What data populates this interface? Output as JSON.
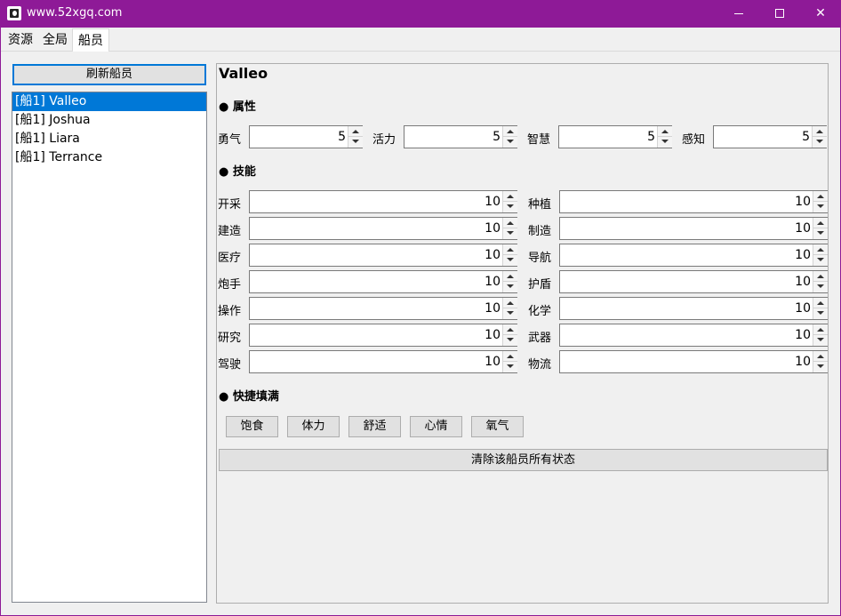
{
  "window": {
    "title": "www.52xgq.com"
  },
  "tabs": [
    {
      "label": "资源"
    },
    {
      "label": "全局"
    },
    {
      "label": "船员"
    }
  ],
  "refresh_label": "刷新船员",
  "crew": [
    {
      "label": "[船1] Valleo"
    },
    {
      "label": "[船1] Joshua"
    },
    {
      "label": "[船1] Liara"
    },
    {
      "label": "[船1] Terrance"
    }
  ],
  "selected_name": "Valleo",
  "attributes_title": "● 属性",
  "attributes": [
    {
      "label": "勇气",
      "value": "5"
    },
    {
      "label": "活力",
      "value": "5"
    },
    {
      "label": "智慧",
      "value": "5"
    },
    {
      "label": "感知",
      "value": "5"
    }
  ],
  "skills_title": "● 技能",
  "skills": [
    {
      "label": "开采",
      "value": "10"
    },
    {
      "label": "种植",
      "value": "10"
    },
    {
      "label": "建造",
      "value": "10"
    },
    {
      "label": "制造",
      "value": "10"
    },
    {
      "label": "医疗",
      "value": "10"
    },
    {
      "label": "导航",
      "value": "10"
    },
    {
      "label": "炮手",
      "value": "10"
    },
    {
      "label": "护盾",
      "value": "10"
    },
    {
      "label": "操作",
      "value": "10"
    },
    {
      "label": "化学",
      "value": "10"
    },
    {
      "label": "研究",
      "value": "10"
    },
    {
      "label": "武器",
      "value": "10"
    },
    {
      "label": "驾驶",
      "value": "10"
    },
    {
      "label": "物流",
      "value": "10"
    }
  ],
  "quickfill_title": "● 快捷填满",
  "quickfill": [
    {
      "label": "饱食"
    },
    {
      "label": "体力"
    },
    {
      "label": "舒适"
    },
    {
      "label": "心情"
    },
    {
      "label": "氧气"
    }
  ],
  "clear_label": "清除该船员所有状态"
}
